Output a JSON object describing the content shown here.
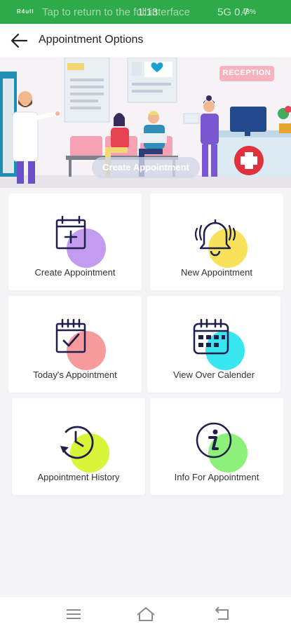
{
  "status_bar": {
    "signal_text": "R4ull",
    "notification_text": "Tap to return to the full interface",
    "time": "1:13",
    "right_text": "5G 0.7",
    "battery": "48%"
  },
  "app_bar": {
    "title": "Appointment Options",
    "back_icon": "back-arrow-icon"
  },
  "banner": {
    "reception_sign": "RECEPTION",
    "button_label": "Create Appointment"
  },
  "options": [
    {
      "label": "Create Appointment",
      "icon": "calendar-plus-icon",
      "blob_color": "#c39cf0"
    },
    {
      "label": "New Appointment",
      "icon": "bell-icon",
      "blob_color": "#f8e25c"
    },
    {
      "label": "Today's Appointment",
      "icon": "calendar-check-icon",
      "blob_color": "#f79a9e"
    },
    {
      "label": "View Over Calender",
      "icon": "calendar-grid-icon",
      "blob_color": "#39e6f0"
    },
    {
      "label": "Appointment History",
      "icon": "history-clock-icon",
      "blob_color": "#d8f53a"
    },
    {
      "label": "Info For Appointment",
      "icon": "info-icon",
      "blob_color": "#8df07a"
    }
  ],
  "nav_bar": {
    "items": [
      {
        "icon": "menu-icon"
      },
      {
        "icon": "home-icon"
      },
      {
        "icon": "back-icon"
      }
    ]
  }
}
